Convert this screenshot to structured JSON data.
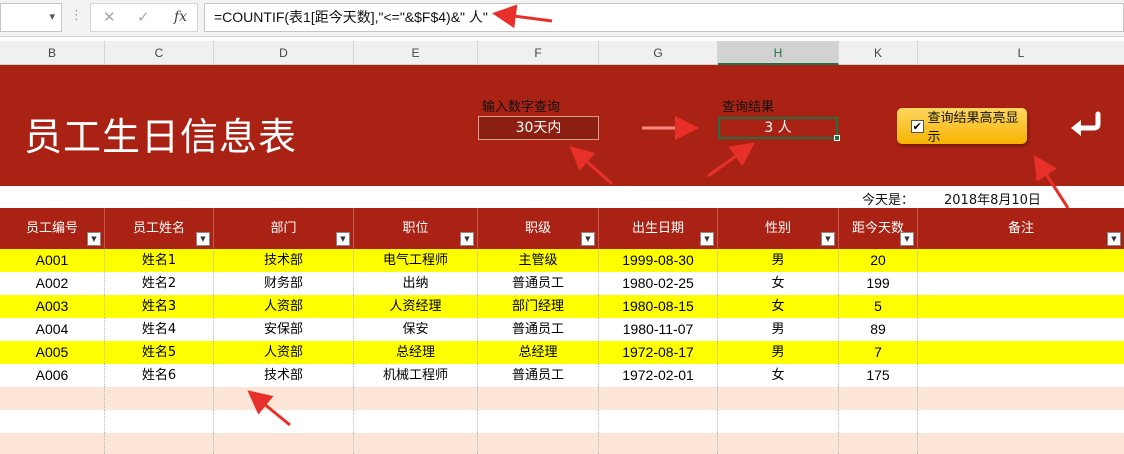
{
  "formula_bar": {
    "formula": "=COUNTIF(表1[距今天数],\"<=\"&$F$4)&\" 人\"",
    "cancel_icon": "close-icon",
    "enter_icon": "check-icon",
    "fx_label": "fx"
  },
  "columns": [
    "B",
    "C",
    "D",
    "E",
    "F",
    "G",
    "H",
    "K",
    "L"
  ],
  "active_column": "H",
  "banner": {
    "title": "员工生日信息表",
    "query_label": "输入数字查询",
    "query_value": "30天内",
    "result_label": "查询结果",
    "result_value": "3 人",
    "highlight_label": "查询结果高亮显示",
    "highlight_checked": true,
    "back_icon": "return-arrow-icon",
    "bg_color": "#aa2214"
  },
  "today": {
    "label": "今天是：",
    "value": "2018年8月10日"
  },
  "table": {
    "headers": [
      "员工编号",
      "员工姓名",
      "部门",
      "职位",
      "职级",
      "出生日期",
      "性别",
      "距今天数",
      "备注"
    ],
    "rows": [
      [
        "A001",
        "姓名1",
        "技术部",
        "电气工程师",
        "主管级",
        "1999-08-30",
        "男",
        "20",
        ""
      ],
      [
        "A002",
        "姓名2",
        "财务部",
        "出纳",
        "普通员工",
        "1980-02-25",
        "女",
        "199",
        ""
      ],
      [
        "A003",
        "姓名3",
        "人资部",
        "人资经理",
        "部门经理",
        "1980-08-15",
        "女",
        "5",
        ""
      ],
      [
        "A004",
        "姓名4",
        "安保部",
        "保安",
        "普通员工",
        "1980-11-07",
        "男",
        "89",
        ""
      ],
      [
        "A005",
        "姓名5",
        "人资部",
        "总经理",
        "总经理",
        "1972-08-17",
        "男",
        "7",
        ""
      ],
      [
        "A006",
        "姓名6",
        "技术部",
        "机械工程师",
        "普通员工",
        "1972-02-01",
        "女",
        "175",
        ""
      ]
    ],
    "row_highlight": [
      "yellow",
      "white",
      "yellow",
      "white",
      "yellow",
      "white"
    ],
    "highlight_color": "#ffff00",
    "empty_row_color": "#fde6d8",
    "arrow_color": "#e8302a"
  }
}
